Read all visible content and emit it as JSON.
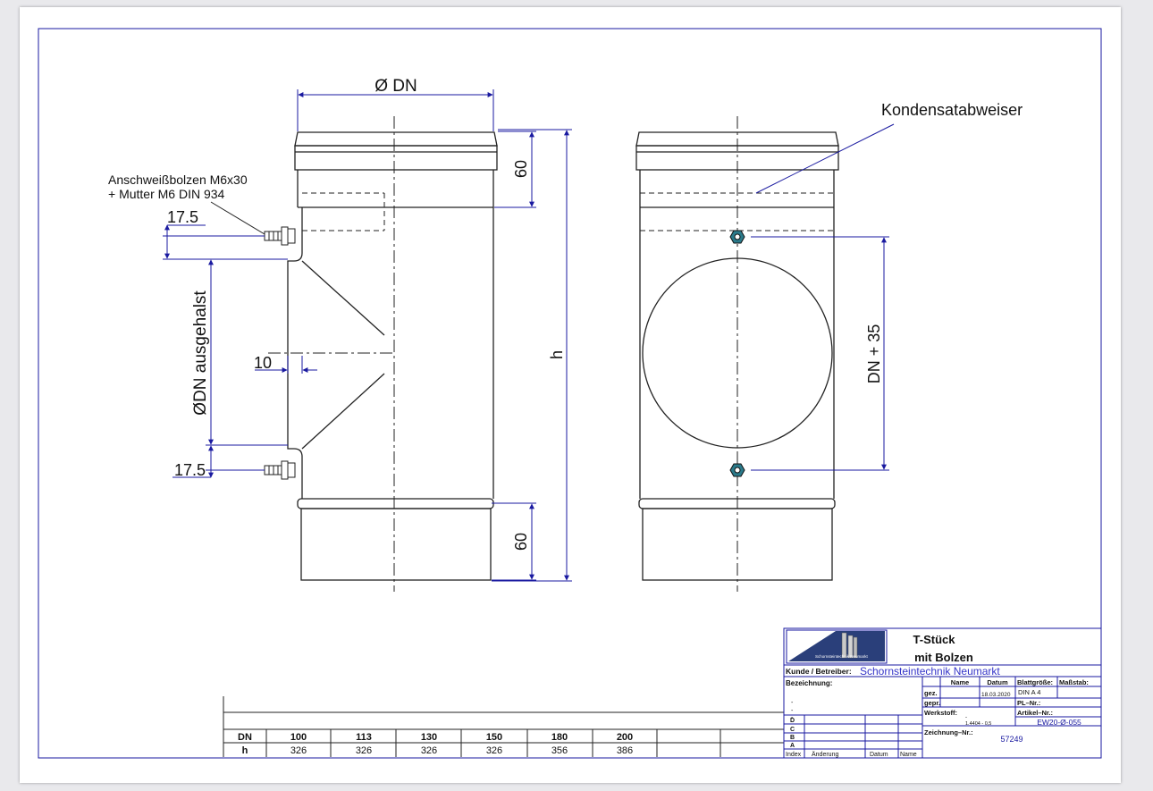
{
  "labels": {
    "diameter_dn": "Ø DN",
    "dim_60_top": "60",
    "dim_60_bottom": "60",
    "dim_h": "h",
    "dim_17_5_top": "17.5",
    "dim_17_5_bottom": "17.5",
    "dim_10": "10",
    "branch_dim": "ØDN ausgehalst",
    "dim_dn_plus": "DN + 35",
    "bolt_note_line1": "Anschweißbolzen M6x30",
    "bolt_note_line2": "+ Mutter M6 DIN 934",
    "condensate": "Kondensatabweiser"
  },
  "table": {
    "row_dn_label": "DN",
    "row_h_label": "h",
    "dn": [
      "100",
      "113",
      "130",
      "150",
      "180",
      "200"
    ],
    "h": [
      "326",
      "326",
      "326",
      "326",
      "356",
      "386"
    ]
  },
  "title_block": {
    "logo_text": "Schornsteintechnik Neumarkt",
    "title_line1": "T-Stück",
    "title_line2": "mit Bolzen",
    "customer_label": "Kunde / Betreiber:",
    "customer_value": "Schornsteintechnik Neumarkt",
    "designation_label": "Bezeichnung:",
    "dash1": "-",
    "dash2": "-",
    "dash3": "-",
    "col_name": "Name",
    "col_date": "Datum",
    "sheet_size_label": "Blattgröße:",
    "scale_label": "Maßstab:",
    "sheet_size_value": "DIN A 4",
    "drawn_label": "gez.",
    "drawn_date": "18.03.2020",
    "checked_label": "gepr.",
    "pl_label": "PL–Nr.:",
    "material_label": "Werkstoff:",
    "material_dash": "-",
    "material_value": "1.4404 - 0,5",
    "article_label": "Artikel–Nr.:",
    "article_value": "EW20-Ø-055",
    "drawing_no_label": "Zeichnung–Nr.:",
    "drawing_no_value": "57249",
    "rev_d": "D",
    "rev_c": "C",
    "rev_b": "B",
    "rev_a": "A",
    "rev_index": "Index",
    "rev_change": "Änderung",
    "rev_date": "Datum",
    "rev_name": "Name"
  },
  "colors": {
    "dimension": "#1a1aa0",
    "part": "#222222",
    "customer_text": "#3434c8"
  }
}
